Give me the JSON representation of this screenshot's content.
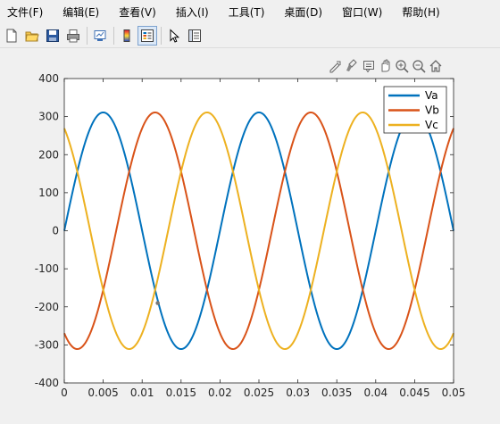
{
  "menu": [
    "文件(F)",
    "编辑(E)",
    "查看(V)",
    "插入(I)",
    "工具(T)",
    "桌面(D)",
    "窗口(W)",
    "帮助(H)"
  ],
  "toolbar": {
    "buttons": [
      "new-figure-icon",
      "open-file-icon",
      "save-icon",
      "print-icon",
      "link-plot-icon",
      "colorbar-icon",
      "legend-icon",
      "pointer-icon",
      "property-inspector-icon"
    ]
  },
  "axes_toolbar": [
    "export-icon",
    "brush-icon",
    "datatip-icon",
    "pan-icon",
    "zoom-in-icon",
    "zoom-out-icon",
    "home-icon"
  ],
  "colors": {
    "Va": "#0072bd",
    "Vb": "#d95319",
    "Vc": "#edb120",
    "background": "#f0f0f0",
    "axes": "#ffffff"
  },
  "chart_data": {
    "type": "line",
    "title": "",
    "xlabel": "",
    "ylabel": "",
    "xlim": [
      0,
      0.05
    ],
    "ylim": [
      -400,
      400
    ],
    "xticks": [
      "0",
      "0.005",
      "0.01",
      "0.015",
      "0.02",
      "0.025",
      "0.03",
      "0.035",
      "0.04",
      "0.045",
      "0.05"
    ],
    "yticks": [
      "400",
      "300",
      "200",
      "100",
      "0",
      "-100",
      "-200",
      "-300",
      "-400"
    ],
    "grid": false,
    "legend_position": "top-right",
    "frequency_hz": 50,
    "amplitude": 311,
    "series": [
      {
        "name": "Va",
        "phase_deg": 0
      },
      {
        "name": "Vb",
        "phase_deg": -120
      },
      {
        "name": "Vc",
        "phase_deg": 120
      }
    ],
    "marker": {
      "x": 0.012,
      "y": -190
    }
  }
}
